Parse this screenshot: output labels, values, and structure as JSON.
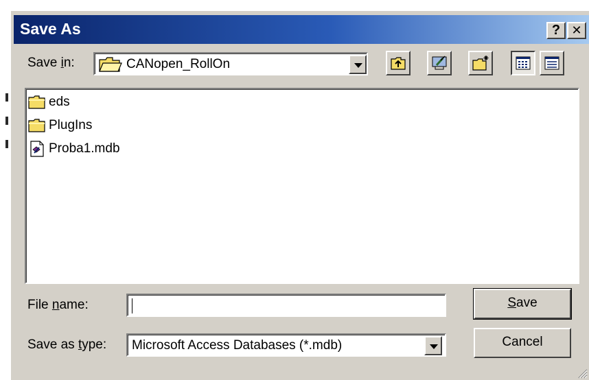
{
  "dialog": {
    "title": "Save As",
    "help_button": "?",
    "close_button": "✕"
  },
  "save_in": {
    "label_prefix": "Save ",
    "label_underlined": "i",
    "label_suffix": "n:",
    "value": "CANopen_RollOn"
  },
  "toolbar": {
    "buttons": [
      "up-one-level",
      "desktop",
      "create-new-folder",
      "list-view",
      "details-view"
    ],
    "pressed": "list-view"
  },
  "files": [
    {
      "name": "eds",
      "icon": "folder-icon"
    },
    {
      "name": "PlugIns",
      "icon": "folder-icon"
    },
    {
      "name": "Proba1.mdb",
      "icon": "access-db-file-icon"
    }
  ],
  "file_name": {
    "label_prefix": "File ",
    "label_underlined": "n",
    "label_suffix": "ame:",
    "value": ""
  },
  "save_as_type": {
    "label_prefix": "Save as ",
    "label_underlined": "t",
    "label_suffix": "ype:",
    "value": "Microsoft Access Databases (*.mdb)"
  },
  "buttons": {
    "save_underlined": "S",
    "save_rest": "ave",
    "cancel": "Cancel"
  },
  "colors": {
    "title_gradient_start": "#0a246a",
    "title_gradient_end": "#a6caf0",
    "dialog_face": "#d4d0c8"
  }
}
